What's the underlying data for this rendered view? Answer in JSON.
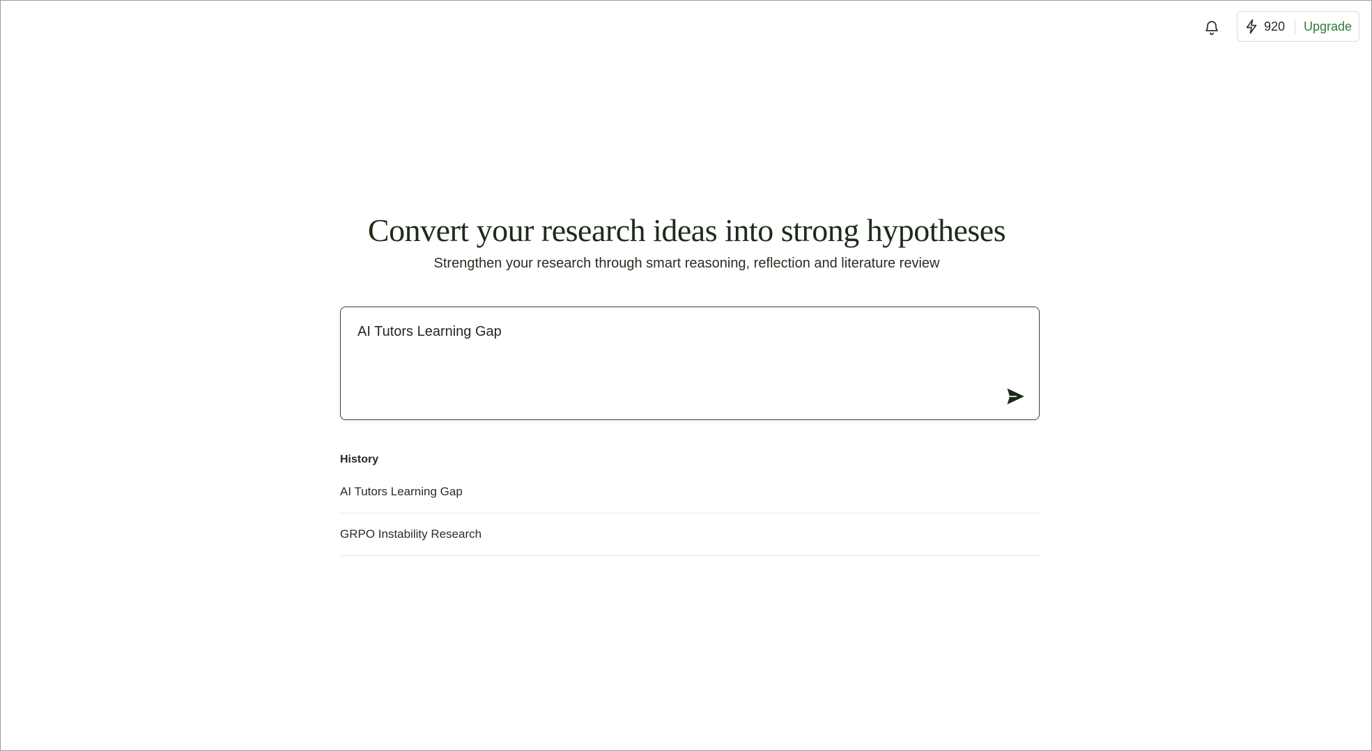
{
  "header": {
    "bell_icon": "bell-icon",
    "credits_icon": "lightning-bolt-icon",
    "credits": "920",
    "upgrade_label": "Upgrade",
    "accent_color": "#2f7a3a"
  },
  "hero": {
    "title": "Convert your research ideas into strong hypotheses",
    "subtitle": "Strengthen your research through smart reasoning, reflection and literature review"
  },
  "prompt": {
    "value": "AI Tutors Learning Gap",
    "send_icon": "send-icon"
  },
  "history": {
    "heading": "History",
    "items": [
      {
        "label": "AI Tutors Learning Gap"
      },
      {
        "label": "GRPO Instability Research"
      }
    ]
  }
}
